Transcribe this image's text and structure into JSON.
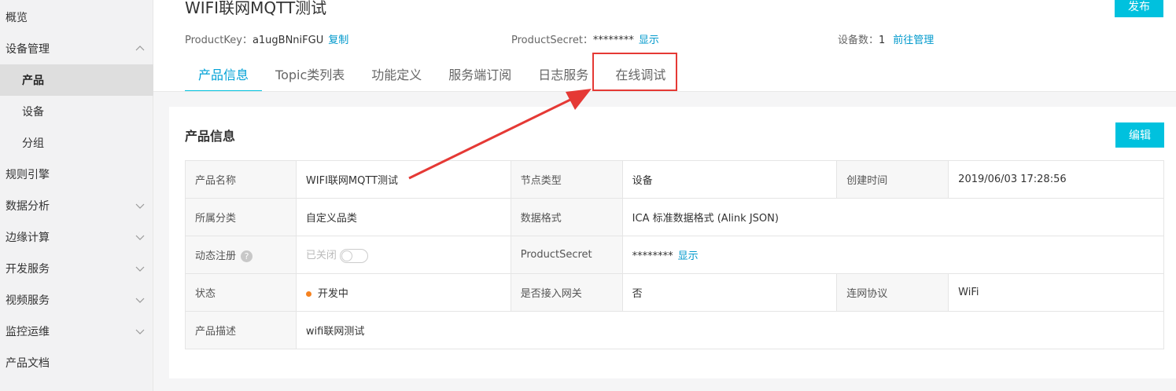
{
  "sidebar": {
    "items": [
      {
        "label": "概览"
      },
      {
        "label": "设备管理"
      },
      {
        "label": "产品"
      },
      {
        "label": "设备"
      },
      {
        "label": "分组"
      },
      {
        "label": "规则引擎"
      },
      {
        "label": "数据分析"
      },
      {
        "label": "边缘计算"
      },
      {
        "label": "开发服务"
      },
      {
        "label": "视频服务"
      },
      {
        "label": "监控运维"
      },
      {
        "label": "产品文档"
      }
    ]
  },
  "header": {
    "title": "WIFI联网MQTT测试",
    "publish_label": "发布",
    "product_key_label": "ProductKey：",
    "product_key_value": "a1ugBNniFGU",
    "copy_label": "复制",
    "product_secret_label": "ProductSecret：",
    "product_secret_value": "********",
    "show_label": "显示",
    "device_count_label": "设备数：",
    "device_count_value": "1",
    "manage_label": "前往管理"
  },
  "tabs": [
    {
      "label": "产品信息"
    },
    {
      "label": "Topic类列表"
    },
    {
      "label": "功能定义"
    },
    {
      "label": "服务端订阅"
    },
    {
      "label": "日志服务"
    },
    {
      "label": "在线调试"
    }
  ],
  "panel": {
    "title": "产品信息",
    "edit_label": "编辑",
    "rows": [
      {
        "l1": "产品名称",
        "v1": "WIFI联网MQTT测试",
        "l2": "节点类型",
        "v2": "设备",
        "l3": "创建时间",
        "v3": "2019/06/03 17:28:56"
      },
      {
        "l1": "所属分类",
        "v1": "自定义品类",
        "l2": "数据格式",
        "v2": "ICA 标准数据格式 (Alink JSON)"
      },
      {
        "l1": "动态注册",
        "v1": "已关闭",
        "l2": "ProductSecret",
        "v2": "********",
        "v2_link": "显示"
      },
      {
        "l1": "状态",
        "v1": "开发中",
        "l2": "是否接入网关",
        "v2": "否",
        "l3": "连网协议",
        "v3": "WiFi"
      },
      {
        "l1": "产品描述",
        "v1": "wifi联网测试"
      }
    ],
    "help_glyph": "?"
  },
  "colors": {
    "accent": "#00c1de",
    "link": "#0099cc",
    "highlight": "#e53935",
    "status_dot": "#f58220"
  }
}
